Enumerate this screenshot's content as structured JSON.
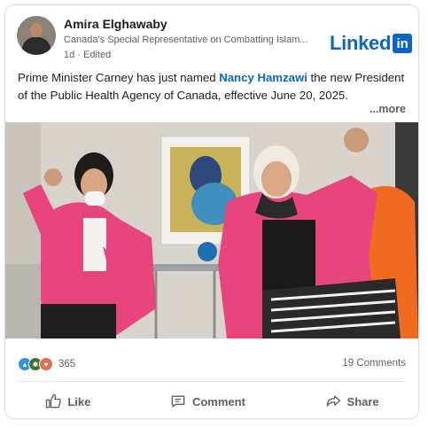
{
  "post": {
    "author": "Amira Elghawaby",
    "headline": "Canada's Special Representative on Combatting Islam...",
    "time": "1d",
    "separator": "·",
    "edited": "Edited",
    "brand": {
      "word": "Linked",
      "box": "in"
    },
    "text_before": "Prime Minister Carney has just named ",
    "mention": "Nancy Hamzawi",
    "text_after": " the new President of the Public Health Agency of Canada, effective June 20, 2025.",
    "more": "...more"
  },
  "social": {
    "reaction_count": "365",
    "comments": "19 Comments",
    "reaction_icons": [
      "like-icon",
      "celebrate-icon",
      "love-icon"
    ]
  },
  "actions": {
    "like": "Like",
    "comment": "Comment",
    "share": "Share"
  },
  "colors": {
    "linkedin_blue": "#0a66c2",
    "pink_blazer": "#e8457f",
    "orange_chair": "#f06a1f"
  }
}
